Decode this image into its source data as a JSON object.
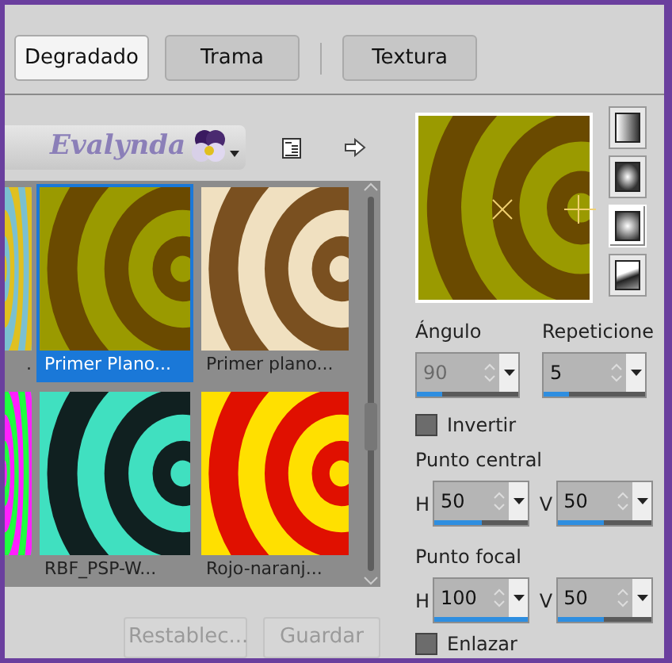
{
  "tabs": [
    {
      "label": "Degradado",
      "selected": true
    },
    {
      "label": "Trama",
      "selected": false
    },
    {
      "label": "Textura",
      "selected": false
    }
  ],
  "preset": {
    "label": "Evalynda"
  },
  "gallery": {
    "items": [
      {
        "label": ".",
        "selected": false
      },
      {
        "label": "Primer Plano...",
        "selected": true
      },
      {
        "label": "Primer plano...",
        "selected": false
      },
      {
        "selected": false
      },
      {
        "label": "RBF_PSP-W...",
        "selected": false
      },
      {
        "label": "Rojo-naranj...",
        "selected": false
      }
    ]
  },
  "actions": [
    {
      "label": "Restablec...",
      "disabled": true
    },
    {
      "label": "Guardar",
      "disabled": true
    }
  ],
  "styles": [
    {
      "kind": "linear",
      "selected": false
    },
    {
      "kind": "rectangular",
      "selected": false
    },
    {
      "kind": "radial",
      "selected": true
    },
    {
      "kind": "corner",
      "selected": false
    }
  ],
  "angle": {
    "label": "Ángulo",
    "value": "90",
    "level": 0.25,
    "disabled": true
  },
  "repeats": {
    "label": "Repeticione",
    "value": "5",
    "level": 0.25,
    "disabled": false
  },
  "invert": {
    "label": "Invertir",
    "checked": false
  },
  "center": {
    "label": "Punto central",
    "h": {
      "axis": "H",
      "value": "50",
      "level": 0.5
    },
    "v": {
      "axis": "V",
      "value": "50",
      "level": 0.5
    }
  },
  "focal": {
    "label": "Punto focal",
    "h": {
      "axis": "H",
      "value": "100",
      "level": 1.0
    },
    "v": {
      "axis": "V",
      "value": "50",
      "level": 0.5
    }
  },
  "link": {
    "label": "Enlazar",
    "checked": false
  }
}
